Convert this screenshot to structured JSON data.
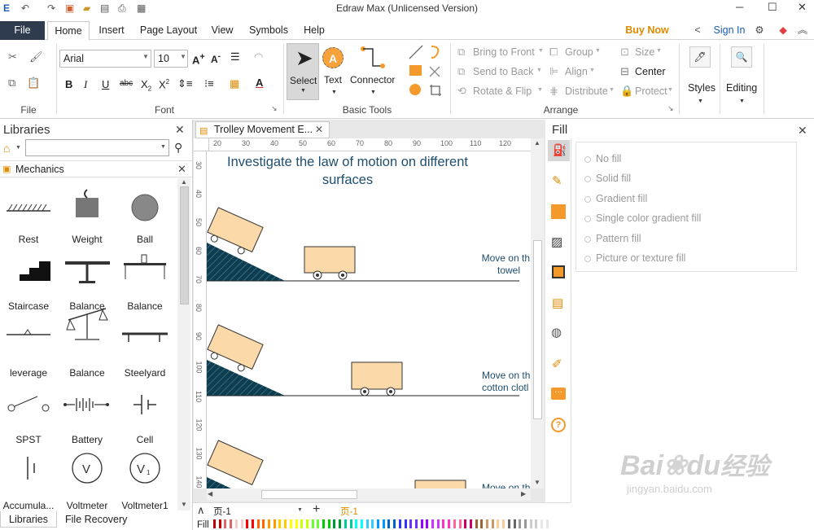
{
  "window": {
    "title": "Edraw Max (Unlicensed Version)"
  },
  "menu": {
    "tabs": [
      "File",
      "Home",
      "Insert",
      "Page Layout",
      "View",
      "Symbols",
      "Help"
    ],
    "buy_now": "Buy Now",
    "sign_in": "Sign In"
  },
  "ribbon": {
    "font_name": "Arial",
    "font_size": "10",
    "groups": {
      "file": "File",
      "font": "Font",
      "basic_tools": "Basic Tools",
      "arrange": "Arrange"
    },
    "basic_tools": {
      "select": "Select",
      "text": "Text",
      "connector": "Connector"
    },
    "arrange": {
      "bring_to_front": "Bring to Front",
      "send_to_back": "Send to Back",
      "rotate_flip": "Rotate & Flip",
      "group": "Group",
      "align": "Align",
      "distribute": "Distribute",
      "size": "Size",
      "center": "Center",
      "protect": "Protect"
    },
    "styles": "Styles",
    "editing": "Editing"
  },
  "libraries": {
    "title": "Libraries",
    "section": "Mechanics",
    "items": [
      "Rest",
      "Weight",
      "Ball",
      "Staircase",
      "Balance",
      "Balance",
      "leverage",
      "Balance",
      "Steelyard",
      "SPST",
      "Battery",
      "Cell",
      "Accumula...",
      "Voltmeter",
      "Voltmeter1"
    ],
    "bottom_tabs": [
      "Libraries",
      "File Recovery"
    ]
  },
  "document": {
    "tab_title": "Trolley Movement E...",
    "heading_line1": "Investigate the law of motion on different",
    "heading_line2": "surfaces",
    "label1_line1": "Move on th",
    "label1_line2": "towel",
    "label2_line1": "Move on th",
    "label2_line2": "cotton clotl",
    "label3_line1": "Move on th"
  },
  "ruler": {
    "h": [
      "20",
      "30",
      "40",
      "50",
      "60",
      "70",
      "80",
      "90",
      "100",
      "110",
      "120"
    ],
    "v": [
      "30",
      "40",
      "50",
      "60",
      "70",
      "80",
      "90",
      "100",
      "110",
      "120",
      "130",
      "140"
    ]
  },
  "fill_panel": {
    "title": "Fill",
    "options": [
      "No fill",
      "Solid fill",
      "Gradient fill",
      "Single color gradient fill",
      "Pattern fill",
      "Picture or texture fill"
    ]
  },
  "statusbar": {
    "page_select": "页-1",
    "page_tab": "页-1",
    "fill_label": "Fill"
  },
  "colors": {
    "palette": [
      "#c00000",
      "#e06666",
      "#f4cccc",
      "#ff0000",
      "#ff6600",
      "#ff9900",
      "#ffcc00",
      "#ffff00",
      "#ccff00",
      "#66ff33",
      "#00cc00",
      "#009933",
      "#00cc99",
      "#00ffff",
      "#33ccff",
      "#0099ff",
      "#0066cc",
      "#3333ff",
      "#6633ff",
      "#9900ff",
      "#cc33ff",
      "#ff33cc",
      "#ff6699",
      "#cc0066",
      "#996633",
      "#cc9966",
      "#ffcc99",
      "#666666",
      "#999999",
      "#cccccc",
      "#e6e6e6",
      "#ffffff"
    ]
  },
  "watermark": {
    "line1": "Bai",
    "line2": "du",
    "line3": "经验",
    "url": "jingyan.baidu.com"
  }
}
